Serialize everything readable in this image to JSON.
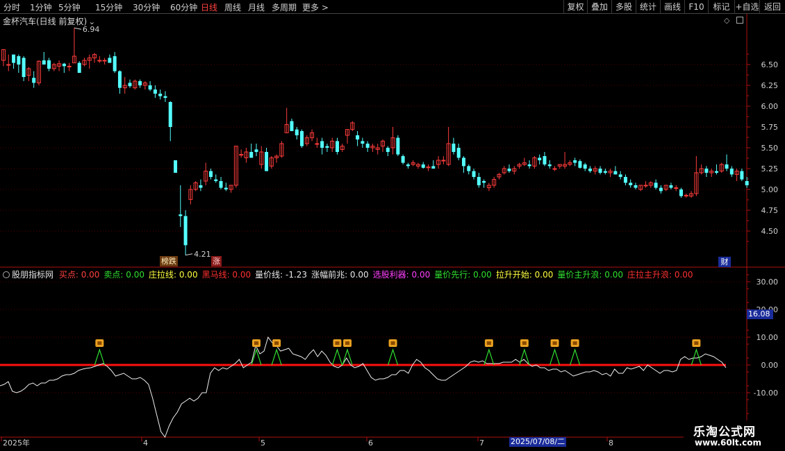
{
  "toolbar": {
    "periods": [
      "分时",
      "1分钟",
      "5分钟",
      "15分钟",
      "30分钟",
      "60分钟",
      "日线",
      "周线",
      "月线",
      "多周期",
      "更多 >"
    ],
    "active_period": "日线",
    "right_buttons": [
      "复权",
      "叠加",
      "多股",
      "统计",
      "画线",
      "F10",
      "标记",
      "+自选",
      "返回"
    ]
  },
  "main_chart": {
    "title": "金杯汽车(日线 前复权)",
    "high_label": "6.94",
    "low_label": "4.21",
    "y_ticks": [
      "6.50",
      "6.25",
      "6.00",
      "5.75",
      "5.50",
      "5.25",
      "5.00",
      "4.75",
      "4.50"
    ],
    "signal_bang": "榜跌",
    "signal_zhang": "涨",
    "cai_badge": "财"
  },
  "indicator": {
    "name": "股朋指标网",
    "items": [
      {
        "label": "买点",
        "value": "0.00",
        "color": "#ff4040"
      },
      {
        "label": "卖点",
        "value": "0.00",
        "color": "#30e030"
      },
      {
        "label": "庄拉线",
        "value": "0.00",
        "color": "#ffff40"
      },
      {
        "label": "黑马线",
        "value": "0.00",
        "color": "#ff3030"
      },
      {
        "label": "量价线",
        "value": "-1.23",
        "color": "#e8e8e8"
      },
      {
        "label": "涨幅前兆",
        "value": "0.00",
        "color": "#e8e8e8"
      },
      {
        "label": "选股利器",
        "value": "0.00",
        "color": "#ff40ff"
      },
      {
        "label": "量价先行",
        "value": "0.00",
        "color": "#30e030"
      },
      {
        "label": "拉升开始",
        "value": "0.00",
        "color": "#ffff40"
      },
      {
        "label": "量价主升浪",
        "value": "0.00",
        "color": "#30e030"
      },
      {
        "label": "庄拉主升浪",
        "value": "0.00",
        "color": "#ff3030"
      }
    ],
    "y_ticks": [
      "30.00",
      "20.00",
      "10.00",
      "0.00",
      "-10.00"
    ],
    "axis_badge": "16.08",
    "buy_marker_count": 11
  },
  "x_axis": {
    "labels": [
      "2025年",
      "4",
      "5",
      "6",
      "7",
      "8"
    ],
    "date_badge": "2025/07/08/二"
  },
  "watermark": {
    "title": "乐淘公式网",
    "url": "www.60lt.com"
  },
  "colors": {
    "up": "#ff3c3c",
    "down": "#54ffff",
    "axis_red": "#b01010",
    "zero_line": "#ff1010",
    "badge_blue": "#1a2c9a",
    "marker_gold": "#e8a020"
  },
  "chart_data": {
    "type": "candlestick",
    "title": "金杯汽车(日线 前复权)",
    "price_range": [
      4.21,
      6.94
    ],
    "ylim": [
      4.3,
      6.75
    ],
    "candles": [
      [
        6.55,
        6.68,
        6.48,
        6.68
      ],
      [
        6.5,
        6.62,
        6.42,
        6.5
      ],
      [
        6.62,
        6.62,
        6.45,
        6.52
      ],
      [
        6.6,
        6.62,
        6.4,
        6.5
      ],
      [
        6.58,
        6.6,
        6.3,
        6.35
      ],
      [
        6.37,
        6.47,
        6.3,
        6.45
      ],
      [
        6.34,
        6.42,
        6.22,
        6.28
      ],
      [
        6.28,
        6.55,
        6.25,
        6.54
      ],
      [
        6.55,
        6.65,
        6.5,
        6.5
      ],
      [
        6.55,
        6.58,
        6.42,
        6.45
      ],
      [
        6.45,
        6.52,
        6.42,
        6.5
      ],
      [
        6.48,
        6.55,
        6.42,
        6.51
      ],
      [
        6.51,
        6.52,
        6.4,
        6.48
      ],
      [
        6.48,
        6.52,
        6.42,
        6.48
      ],
      [
        6.52,
        6.94,
        6.52,
        6.6
      ],
      [
        6.52,
        6.54,
        6.4,
        6.4
      ],
      [
        6.5,
        6.58,
        6.48,
        6.55
      ],
      [
        6.55,
        6.62,
        6.45,
        6.58
      ],
      [
        6.58,
        6.64,
        6.52,
        6.62
      ],
      [
        6.55,
        6.6,
        6.52,
        6.55
      ],
      [
        6.55,
        6.58,
        6.5,
        6.55
      ],
      [
        6.58,
        6.62,
        6.52,
        6.52
      ],
      [
        6.6,
        6.65,
        6.4,
        6.42
      ],
      [
        6.42,
        6.43,
        6.15,
        6.22
      ],
      [
        6.22,
        6.35,
        6.15,
        6.25
      ],
      [
        6.28,
        6.32,
        6.22,
        6.24
      ],
      [
        6.22,
        6.32,
        6.2,
        6.3
      ],
      [
        6.3,
        6.32,
        6.22,
        6.25
      ],
      [
        6.25,
        6.3,
        6.2,
        6.28
      ],
      [
        6.25,
        6.3,
        6.18,
        6.2
      ],
      [
        6.2,
        6.25,
        6.1,
        6.15
      ],
      [
        6.15,
        6.2,
        6.08,
        6.12
      ],
      [
        6.12,
        6.18,
        6.05,
        6.1
      ],
      [
        6.05,
        6.06,
        5.58,
        5.75
      ],
      [
        5.35,
        5.35,
        5.2,
        5.2
      ],
      [
        4.7,
        5.05,
        4.55,
        4.68
      ],
      [
        4.68,
        4.75,
        4.21,
        4.33
      ],
      [
        4.88,
        5.05,
        4.82,
        5.0
      ],
      [
        5.0,
        5.1,
        4.98,
        5.08
      ],
      [
        5.05,
        5.12,
        4.98,
        5.02
      ],
      [
        5.1,
        5.32,
        5.05,
        5.22
      ],
      [
        5.22,
        5.25,
        5.12,
        5.15
      ],
      [
        5.12,
        5.18,
        5.08,
        5.1
      ],
      [
        5.1,
        5.15,
        5.0,
        5.02
      ],
      [
        5.02,
        5.08,
        4.98,
        5.0
      ],
      [
        5.0,
        5.05,
        4.96,
        5.05
      ],
      [
        5.05,
        5.52,
        5.02,
        5.52
      ],
      [
        5.42,
        5.48,
        5.38,
        5.42
      ],
      [
        5.38,
        5.5,
        5.32,
        5.45
      ],
      [
        5.45,
        5.55,
        5.38,
        5.38
      ],
      [
        5.48,
        5.55,
        5.4,
        5.45
      ],
      [
        5.3,
        5.52,
        5.25,
        5.45
      ],
      [
        5.45,
        5.5,
        5.22,
        5.22
      ],
      [
        5.28,
        5.4,
        5.25,
        5.38
      ],
      [
        5.38,
        5.42,
        5.32,
        5.4
      ],
      [
        5.4,
        5.58,
        5.38,
        5.55
      ],
      [
        5.68,
        5.98,
        5.68,
        5.78
      ],
      [
        5.82,
        5.85,
        5.7,
        5.7
      ],
      [
        5.72,
        5.75,
        5.6,
        5.65
      ],
      [
        5.7,
        5.72,
        5.5,
        5.52
      ],
      [
        5.55,
        5.65,
        5.52,
        5.62
      ],
      [
        5.62,
        5.72,
        5.58,
        5.68
      ],
      [
        5.55,
        5.62,
        5.5,
        5.55
      ],
      [
        5.58,
        5.62,
        5.42,
        5.5
      ],
      [
        5.52,
        5.55,
        5.45,
        5.5
      ],
      [
        5.5,
        5.62,
        5.45,
        5.58
      ],
      [
        5.58,
        5.62,
        5.42,
        5.45
      ],
      [
        5.48,
        5.55,
        5.45,
        5.52
      ],
      [
        5.65,
        5.72,
        5.55,
        5.72
      ],
      [
        5.72,
        5.82,
        5.7,
        5.8
      ],
      [
        5.65,
        5.7,
        5.52,
        5.6
      ],
      [
        5.58,
        5.62,
        5.5,
        5.55
      ],
      [
        5.55,
        5.58,
        5.45,
        5.5
      ],
      [
        5.5,
        5.55,
        5.45,
        5.52
      ],
      [
        5.48,
        5.55,
        5.42,
        5.5
      ],
      [
        5.52,
        5.6,
        5.45,
        5.58
      ],
      [
        5.5,
        5.52,
        5.4,
        5.45
      ],
      [
        5.5,
        5.75,
        5.42,
        5.62
      ],
      [
        5.62,
        5.65,
        5.4,
        5.42
      ],
      [
        5.4,
        5.42,
        5.3,
        5.32
      ],
      [
        5.3,
        5.32,
        5.25,
        5.28
      ],
      [
        5.3,
        5.35,
        5.28,
        5.32
      ],
      [
        5.28,
        5.32,
        5.25,
        5.3
      ],
      [
        5.3,
        5.33,
        5.25,
        5.26
      ],
      [
        5.26,
        5.3,
        5.22,
        5.27
      ],
      [
        5.28,
        5.35,
        5.25,
        5.25
      ],
      [
        5.3,
        5.4,
        5.25,
        5.35
      ],
      [
        5.35,
        5.4,
        5.3,
        5.35
      ],
      [
        5.3,
        5.75,
        5.28,
        5.55
      ],
      [
        5.55,
        5.62,
        5.42,
        5.45
      ],
      [
        5.5,
        5.55,
        5.35,
        5.38
      ],
      [
        5.38,
        5.4,
        5.2,
        5.28
      ],
      [
        5.28,
        5.3,
        5.18,
        5.22
      ],
      [
        5.22,
        5.25,
        5.12,
        5.15
      ],
      [
        5.15,
        5.2,
        5.02,
        5.05
      ],
      [
        5.1,
        5.12,
        5.02,
        5.08
      ],
      [
        5.02,
        5.08,
        4.98,
        5.05
      ],
      [
        5.05,
        5.15,
        5.02,
        5.12
      ],
      [
        5.15,
        5.2,
        5.12,
        5.18
      ],
      [
        5.2,
        5.28,
        5.18,
        5.25
      ],
      [
        5.25,
        5.3,
        5.2,
        5.22
      ],
      [
        5.22,
        5.28,
        5.18,
        5.25
      ],
      [
        5.28,
        5.32,
        5.25,
        5.3
      ],
      [
        5.3,
        5.38,
        5.28,
        5.32
      ],
      [
        5.3,
        5.35,
        5.25,
        5.28
      ],
      [
        5.28,
        5.4,
        5.25,
        5.38
      ],
      [
        5.38,
        5.42,
        5.3,
        5.35
      ],
      [
        5.4,
        5.45,
        5.28,
        5.3
      ],
      [
        5.3,
        5.35,
        5.25,
        5.28
      ],
      [
        5.25,
        5.28,
        5.22,
        5.25
      ],
      [
        5.28,
        5.3,
        5.25,
        5.3
      ],
      [
        5.28,
        5.45,
        5.25,
        5.3
      ],
      [
        5.3,
        5.35,
        5.28,
        5.32
      ],
      [
        5.35,
        5.38,
        5.28,
        5.32
      ],
      [
        5.34,
        5.36,
        5.25,
        5.26
      ],
      [
        5.3,
        5.32,
        5.22,
        5.25
      ],
      [
        5.25,
        5.28,
        5.2,
        5.22
      ],
      [
        5.22,
        5.28,
        5.18,
        5.25
      ],
      [
        5.25,
        5.28,
        5.18,
        5.2
      ],
      [
        5.22,
        5.25,
        5.18,
        5.2
      ],
      [
        5.2,
        5.25,
        5.15,
        5.22
      ],
      [
        5.22,
        5.28,
        5.18,
        5.18
      ],
      [
        5.18,
        5.22,
        5.12,
        5.15
      ],
      [
        5.15,
        5.18,
        5.05,
        5.08
      ],
      [
        5.08,
        5.12,
        5.02,
        5.05
      ],
      [
        5.05,
        5.08,
        5.0,
        5.02
      ],
      [
        5.0,
        5.05,
        4.98,
        5.05
      ],
      [
        5.05,
        5.1,
        5.02,
        5.05
      ],
      [
        5.05,
        5.1,
        5.02,
        5.08
      ],
      [
        5.08,
        5.12,
        5.0,
        5.02
      ],
      [
        5.02,
        5.05,
        4.95,
        4.98
      ],
      [
        5.0,
        5.05,
        4.98,
        5.05
      ],
      [
        5.05,
        5.08,
        5.0,
        5.02
      ],
      [
        5.02,
        5.05,
        4.98,
        5.02
      ],
      [
        5.0,
        5.02,
        4.9,
        4.92
      ],
      [
        4.92,
        4.95,
        4.9,
        4.93
      ],
      [
        4.92,
        4.98,
        4.9,
        4.95
      ],
      [
        4.95,
        5.4,
        4.92,
        5.2
      ],
      [
        5.2,
        5.3,
        5.18,
        5.25
      ],
      [
        5.25,
        5.28,
        5.15,
        5.2
      ],
      [
        5.2,
        5.25,
        5.15,
        5.22
      ],
      [
        5.22,
        5.3,
        5.18,
        5.2
      ],
      [
        5.22,
        5.32,
        5.2,
        5.3
      ],
      [
        5.3,
        5.42,
        5.22,
        5.25
      ],
      [
        5.25,
        5.28,
        5.15,
        5.18
      ],
      [
        5.18,
        5.25,
        5.1,
        5.22
      ],
      [
        5.22,
        5.25,
        5.1,
        5.12
      ],
      [
        5.1,
        5.15,
        5.02,
        5.05
      ]
    ],
    "indicator_line": [
      -7.5,
      -7,
      -6,
      -9.5,
      -10,
      -9.5,
      -8.5,
      -7,
      -6.5,
      -7.5,
      -6.5,
      -6.5,
      -5.5,
      -5.5,
      -5,
      -4,
      -3.5,
      -3.5,
      -3,
      -2,
      -1.5,
      -1.2,
      -1,
      -0.5,
      0,
      0.5,
      -0.5,
      -2,
      -4,
      -3.5,
      -3,
      -4,
      -5,
      -5,
      -4.5,
      -5.5,
      -7,
      -12,
      -18,
      -24,
      -26,
      -22,
      -19,
      -17,
      -14,
      -13,
      -12,
      -13,
      -12,
      -10,
      -10,
      -3,
      -1,
      -2,
      -1,
      -1.5,
      -0.5,
      0.5,
      2,
      -1,
      0,
      1,
      7,
      4,
      5,
      10,
      8,
      7,
      5,
      5.5,
      6,
      4,
      3.5,
      3,
      2,
      4,
      5.5,
      3,
      5,
      3.5,
      1,
      -0.5,
      -1,
      0,
      2.5,
      0,
      -1,
      -0.5,
      0.5,
      -2,
      -4.5,
      -5.5,
      -5,
      -5,
      -4.5,
      -3.5,
      -3.5,
      -2,
      -2,
      -3,
      0,
      2,
      1,
      -1,
      -2,
      -3.5,
      -5,
      -5.5,
      -5.5,
      -4.5,
      -3.5,
      -2.5,
      -1.5,
      -0.5,
      1,
      1.5,
      1,
      1.5,
      0.5,
      0.5,
      0.5,
      0.5,
      1,
      1,
      1,
      2,
      1,
      2,
      0.5,
      -0.5,
      0,
      -1,
      -1,
      -2,
      -1.5,
      -1.5,
      -2.5,
      -2,
      -3,
      -4,
      -3.5,
      -3,
      -2.5,
      -2.5,
      -2,
      -2.5,
      -3.5,
      -3,
      -4,
      -1.5,
      -3,
      -3,
      -1,
      -1.5,
      -1,
      -0.5,
      -2,
      0,
      -1,
      -2,
      -3,
      -2,
      -2,
      -2.5,
      -2,
      2,
      3,
      2,
      2.5,
      2.5,
      3,
      4,
      3.5,
      3,
      2,
      1,
      -1
    ],
    "buy_signal_indices": [
      19,
      50,
      54,
      66,
      68,
      77,
      96,
      103,
      109,
      113,
      137
    ]
  }
}
